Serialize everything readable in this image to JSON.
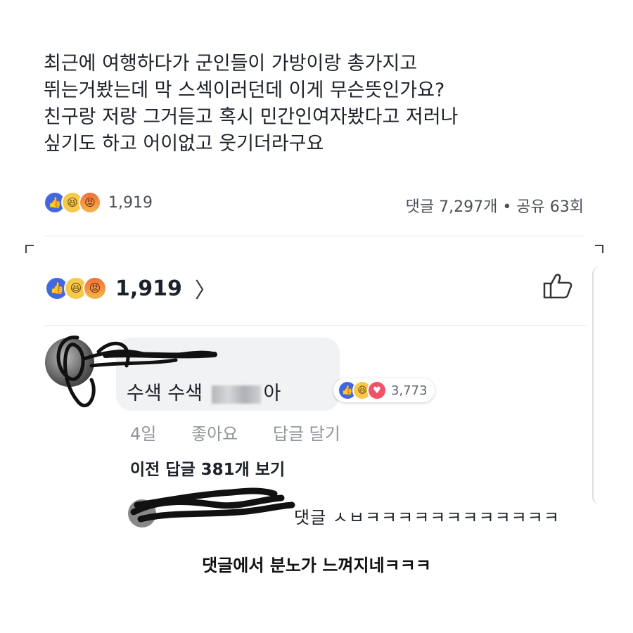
{
  "post": {
    "lines": [
      "최근에 여행하다가 군인들이 가방이랑 총가지고",
      "뛰는거봤는데 막 스섹이러던데 이게 무슨뜻인가요?",
      "친구랑 저랑 그거듣고 혹시 민간인여자봤다고 저러나",
      "싶기도 하고 어이없고 웃기더라구요"
    ],
    "reaction_count": "1,919",
    "stats": "댓글 7,297개 • 공유 63회"
  },
  "detail": {
    "reaction_count": "1,919",
    "chevron": "〉"
  },
  "comment": {
    "text_start": "수색 수색 ",
    "text_end": "아",
    "reaction_count": "3,773",
    "time": "4일",
    "like_label": "좋아요",
    "reply_label": "답글 달기",
    "view_previous": "이전 답글 381개 보기",
    "reply_preview": "댓글 ㅅㅂㅋㅋㅋㅋㅋㅋㅋㅋㅋㅋㅋㅋ"
  },
  "caption": "댓글에서 분노가 느껴지네ㅋㅋㅋ",
  "colors": {
    "like": "#4267e0",
    "haha": "#f6c94a",
    "love": "#f25268"
  },
  "icons": [
    "like-icon",
    "haha-icon",
    "angry-icon",
    "love-icon",
    "thumbs-up-icon",
    "chevron-right-icon"
  ]
}
